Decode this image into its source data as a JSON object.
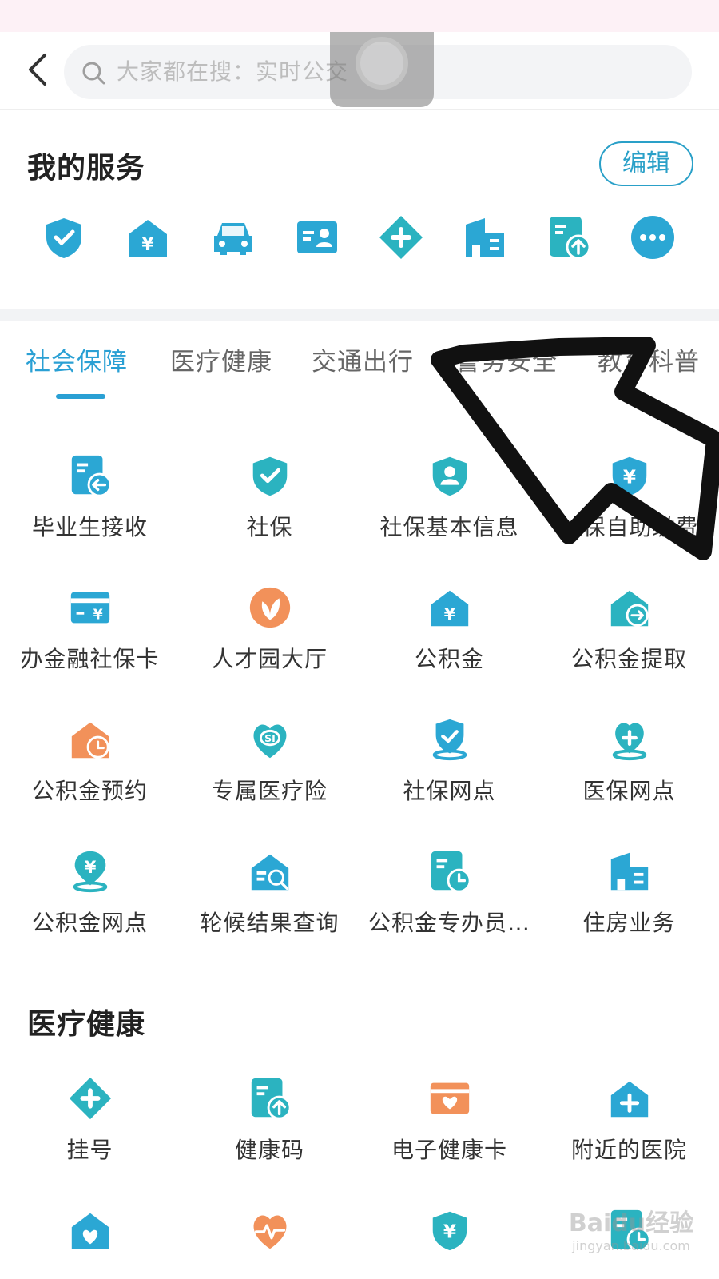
{
  "header": {
    "search_placeholder": "大家都在搜：实时公交",
    "icons": {
      "back": "back-arrow-icon",
      "search": "search-icon"
    }
  },
  "my_services": {
    "title": "我的服务",
    "edit_label": "编辑",
    "icons": [
      "shield-check-icon",
      "house-yuan-icon",
      "car-icon",
      "id-card-icon",
      "medical-diamond-icon",
      "building-icon",
      "document-upload-icon",
      "more-icon"
    ],
    "icon_color": "#2ba7d4"
  },
  "tabs": [
    "社会保障",
    "医疗健康",
    "交通出行",
    "警务安全",
    "教育科普"
  ],
  "social_security": {
    "items": [
      {
        "label": "毕业生接收",
        "icon": "document-receive-icon",
        "color": "#2ba7d4"
      },
      {
        "label": "社保",
        "icon": "shield-check-icon",
        "color": "#2bb3c0"
      },
      {
        "label": "社保基本信息",
        "icon": "shield-person-icon",
        "color": "#2bb3c0"
      },
      {
        "label": "社保自助缴费",
        "icon": "shield-yuan-icon",
        "color": "#2ba7d4"
      },
      {
        "label": "办金融社保卡",
        "icon": "card-yuan-icon",
        "color": "#2ba7d4"
      },
      {
        "label": "人才园大厅",
        "icon": "leaf-icon",
        "color": "#f2915a"
      },
      {
        "label": "公积金",
        "icon": "house-yuan-icon",
        "color": "#2ba7d4"
      },
      {
        "label": "公积金提取",
        "icon": "house-arrow-icon",
        "color": "#2bb3c0"
      },
      {
        "label": "公积金预约",
        "icon": "house-clock-icon",
        "color": "#f2915a"
      },
      {
        "label": "专属医疗险",
        "icon": "heart-si-icon",
        "color": "#2bb3c0"
      },
      {
        "label": "社保网点",
        "icon": "location-shield-icon",
        "color": "#2ba7d4"
      },
      {
        "label": "医保网点",
        "icon": "location-heart-icon",
        "color": "#2bb3c0"
      },
      {
        "label": "公积金网点",
        "icon": "location-yuan-icon",
        "color": "#2bb3c0"
      },
      {
        "label": "轮候结果查询",
        "icon": "house-search-icon",
        "color": "#2ba7d4"
      },
      {
        "label": "公积金专办员…",
        "icon": "document-clock-icon",
        "color": "#2bb3c0"
      },
      {
        "label": "住房业务",
        "icon": "building-icon",
        "color": "#2ba7d4"
      }
    ]
  },
  "medical": {
    "title": "医疗健康",
    "items": [
      {
        "label": "挂号",
        "icon": "medical-diamond-icon",
        "color": "#2bb3c0"
      },
      {
        "label": "健康码",
        "icon": "document-upload-icon",
        "color": "#2bb3c0"
      },
      {
        "label": "电子健康卡",
        "icon": "card-heart-icon",
        "color": "#f2915a"
      },
      {
        "label": "附近的医院",
        "icon": "house-plus-icon",
        "color": "#2ba7d4"
      },
      {
        "label": "",
        "icon": "house-heart-icon",
        "color": "#2ba7d4"
      },
      {
        "label": "",
        "icon": "heart-pulse-icon",
        "color": "#f2915a"
      },
      {
        "label": "",
        "icon": "shield-yuan-icon",
        "color": "#2bb3c0"
      },
      {
        "label": "",
        "icon": "document-clock-icon",
        "color": "#2bb3c0"
      }
    ]
  },
  "overlay": {
    "watermark_text": "Baidu经验",
    "watermark_sub": "jingyan.baidu.com"
  }
}
